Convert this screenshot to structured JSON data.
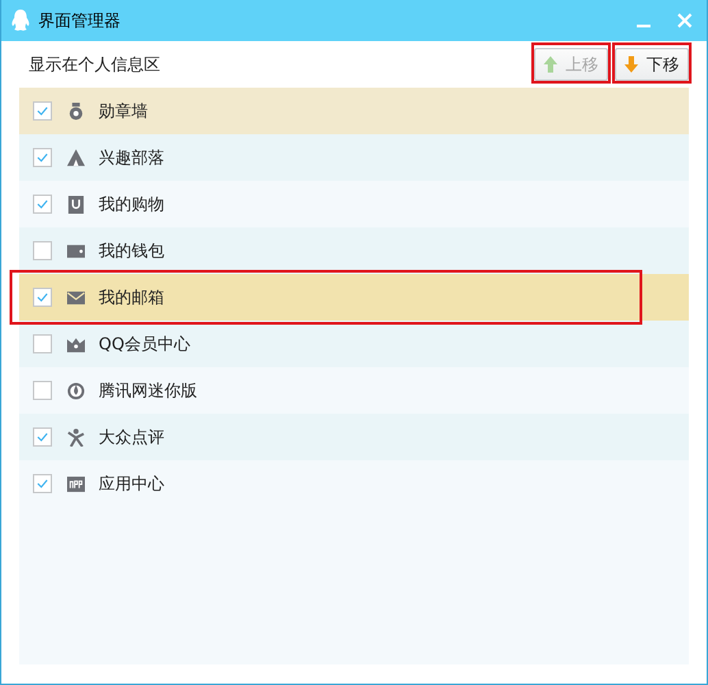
{
  "window": {
    "title": "界面管理器"
  },
  "section_label": "显示在个人信息区",
  "buttons": [
    {
      "kind": "up",
      "label": "上移",
      "disabled": true,
      "annotated": true
    },
    {
      "kind": "down",
      "label": "下移",
      "disabled": false,
      "annotated": true
    }
  ],
  "items": [
    {
      "kind": "medal",
      "label": "勋章墙",
      "checked": true,
      "selected": false,
      "hovered": true,
      "annotated": false
    },
    {
      "kind": "tent",
      "label": "兴趣部落",
      "checked": true,
      "selected": false,
      "hovered": false,
      "annotated": false
    },
    {
      "kind": "bag",
      "label": "我的购物",
      "checked": true,
      "selected": false,
      "hovered": false,
      "annotated": false
    },
    {
      "kind": "wallet",
      "label": "我的钱包",
      "checked": false,
      "selected": false,
      "hovered": false,
      "annotated": false
    },
    {
      "kind": "mail",
      "label": "我的邮箱",
      "checked": true,
      "selected": true,
      "hovered": false,
      "annotated": true
    },
    {
      "kind": "crown",
      "label": "QQ会员中心",
      "checked": false,
      "selected": false,
      "hovered": false,
      "annotated": false
    },
    {
      "kind": "drop",
      "label": "腾讯网迷你版",
      "checked": false,
      "selected": false,
      "hovered": false,
      "annotated": false
    },
    {
      "kind": "person",
      "label": "大众点评",
      "checked": true,
      "selected": false,
      "hovered": false,
      "annotated": false
    },
    {
      "kind": "app",
      "label": "应用中心",
      "checked": true,
      "selected": false,
      "hovered": false,
      "annotated": false
    }
  ]
}
